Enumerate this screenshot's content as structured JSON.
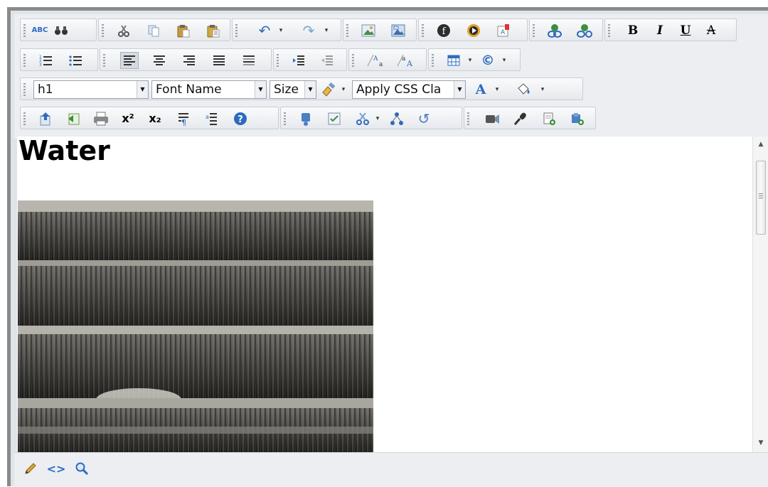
{
  "toolbar": {
    "row1": {
      "spellcheck_label": "ABC",
      "find_icon": "binoculars-icon",
      "cut_icon": "scissors-icon",
      "copy_icon": "copy-icon",
      "paste_icon": "paste-icon",
      "paste_plain_icon": "paste-text-icon",
      "undo_icon": "undo-icon",
      "redo_icon": "redo-icon",
      "image_manager_icon": "image-icon",
      "image_map_icon": "image-map-icon",
      "flash_icon": "flash-icon",
      "media_icon": "media-icon",
      "document_icon": "document-icon",
      "link_icon": "link-icon",
      "unlink_icon": "unlink-icon",
      "bold_label": "B",
      "italic_label": "I",
      "underline_label": "U",
      "strike_label": "A"
    },
    "row2": {
      "numbered_list_icon": "numbered-list-icon",
      "bullet_list_icon": "bullet-list-icon",
      "align_left_icon": "align-left-icon",
      "align_center_icon": "align-center-icon",
      "align_right_icon": "align-right-icon",
      "justify_icon": "justify-icon",
      "remove_alignment_icon": "remove-alignment-icon",
      "indent_icon": "indent-icon",
      "outdent_icon": "outdent-icon",
      "subscript_style_icon": "font-size-decrease-icon",
      "superscript_style_icon": "font-size-increase-icon",
      "table_icon": "table-icon",
      "symbol_label": "©"
    },
    "row3": {
      "paragraph_value": "h1",
      "font_name_value": "Font Name",
      "size_value": "Size",
      "css_class_value": "Apply CSS Cla",
      "format_stripper_icon": "brush-icon",
      "fore_color_label": "A",
      "back_color_icon": "paint-bucket-icon"
    },
    "row4": {
      "insert_icon": "insert-icon",
      "template_icon": "template-icon",
      "print_icon": "print-icon",
      "superscript_label": "x²",
      "subscript_label": "x₂",
      "paragraph_icon": "paragraph-icon",
      "format_code_icon": "format-code-icon",
      "help_icon": "help-icon",
      "snippet_icon": "snippet-icon",
      "form_icon": "form-icon",
      "module_icon": "module-icon",
      "tracking_icon": "tracking-icon",
      "refresh_icon": "refresh-icon",
      "video_icon": "video-icon",
      "microphone_icon": "microphone-icon",
      "new_doc_icon": "new-doc-icon",
      "add_link_icon": "add-link-icon"
    }
  },
  "content": {
    "heading": "Water",
    "image_description": "waterfall-photo"
  },
  "modes": {
    "design_icon": "pencil-icon",
    "html_label": "<>",
    "preview_icon": "magnifier-icon"
  },
  "colors": {
    "frame_border": "#8a8a8a",
    "toolbar_bg": "#eceef1",
    "editor_bg": "#ffffff",
    "link_green": "#2f8a3a",
    "blue_icon": "#2d6bbf"
  }
}
